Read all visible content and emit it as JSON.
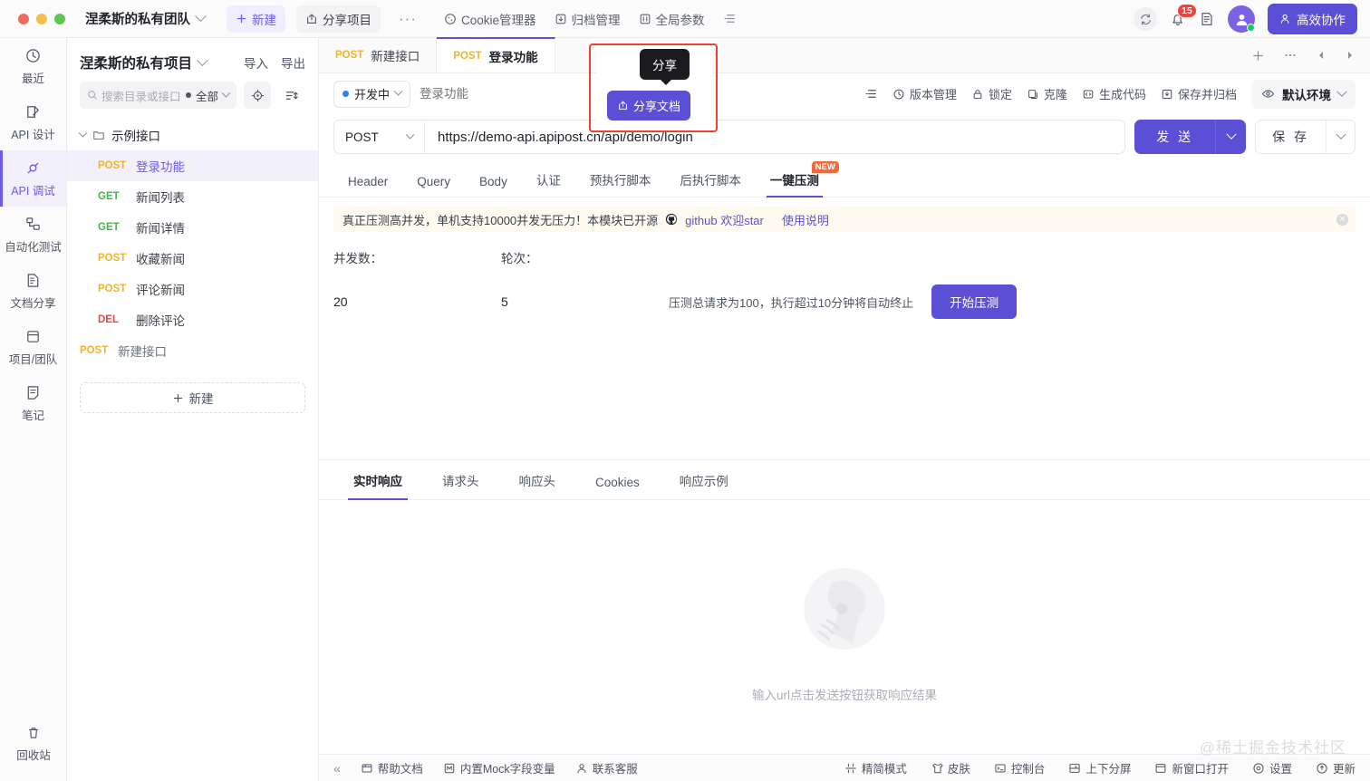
{
  "header": {
    "team_name": "涅柔斯的私有团队",
    "new_label": "新建",
    "share_project_label": "分享项目",
    "more_label": "···",
    "cookie_manager_label": "Cookie管理器",
    "archive_manager_label": "归档管理",
    "global_params_label": "全局参数",
    "notification_count": "15",
    "collab_label": "高效协作"
  },
  "rail": {
    "items": [
      {
        "label": "最近",
        "icon": "history-icon"
      },
      {
        "label": "API 设计",
        "icon": "design-icon"
      },
      {
        "label": "API 调试",
        "icon": "debug-icon"
      },
      {
        "label": "自动化测试",
        "icon": "automation-icon"
      },
      {
        "label": "文档分享",
        "icon": "doc-share-icon"
      },
      {
        "label": "项目/团队",
        "icon": "project-team-icon"
      },
      {
        "label": "笔记",
        "icon": "notes-icon"
      }
    ],
    "recycle_label": "回收站"
  },
  "sidebar": {
    "project_name": "涅柔斯的私有项目",
    "import_label": "导入",
    "export_label": "导出",
    "search_placeholder": "搜索目录或接口",
    "filter_label": "全部",
    "folder_label": "示例接口",
    "apis": [
      {
        "method": "POST",
        "name": "登录功能",
        "selected": true
      },
      {
        "method": "GET",
        "name": "新闻列表",
        "selected": false
      },
      {
        "method": "GET",
        "name": "新闻详情",
        "selected": false
      },
      {
        "method": "POST",
        "name": "收藏新闻",
        "selected": false
      },
      {
        "method": "POST",
        "name": "评论新闻",
        "selected": false
      },
      {
        "method": "DEL",
        "name": "删除评论",
        "selected": false
      }
    ],
    "root_api": {
      "method": "POST",
      "name": "新建接口"
    },
    "new_button_label": "新建"
  },
  "tabs": {
    "items": [
      {
        "method": "POST",
        "title": "新建接口",
        "active": false
      },
      {
        "method": "POST",
        "title": "登录功能",
        "active": true
      }
    ],
    "add_icon": "plus-icon",
    "more_icon": "ellipsis-icon",
    "prev_icon": "triangle-left-icon",
    "next_icon": "triangle-right-icon"
  },
  "request": {
    "status_label": "开发中",
    "name_placeholder": "登录功能",
    "toolbar": [
      {
        "label": "版本管理",
        "icon": "clock-icon"
      },
      {
        "label": "锁定",
        "icon": "lock-icon"
      },
      {
        "label": "克隆",
        "icon": "copy-icon"
      },
      {
        "label": "生成代码",
        "icon": "code-icon"
      },
      {
        "label": "保存并归档",
        "icon": "archive-icon"
      }
    ],
    "env_label": "默认环境",
    "method": "POST",
    "url": "https://demo-api.apipost.cn/api/demo/login",
    "send_label": "发 送",
    "save_label": "保 存"
  },
  "subtabs": [
    {
      "label": "Header",
      "active": false,
      "badge": ""
    },
    {
      "label": "Query",
      "active": false,
      "badge": ""
    },
    {
      "label": "Body",
      "active": false,
      "badge": ""
    },
    {
      "label": "认证",
      "active": false,
      "badge": ""
    },
    {
      "label": "预执行脚本",
      "active": false,
      "badge": ""
    },
    {
      "label": "后执行脚本",
      "active": false,
      "badge": ""
    },
    {
      "label": "一键压测",
      "active": true,
      "badge": "NEW"
    }
  ],
  "banner": {
    "text": "真正压测高并发，单机支持10000并发无压力！本模块已开源",
    "github_label": "github 欢迎star",
    "usage_label": "使用说明"
  },
  "stress": {
    "concurrency_label": "并发数：",
    "rounds_label": "轮次：",
    "concurrency_value": "20",
    "rounds_value": "5",
    "hint": "压测总请求为100，执行超过10分钟将自动终止",
    "start_label": "开始压测"
  },
  "response": {
    "tabs": [
      {
        "label": "实时响应",
        "active": true
      },
      {
        "label": "请求头",
        "active": false
      },
      {
        "label": "响应头",
        "active": false
      },
      {
        "label": "Cookies",
        "active": false
      },
      {
        "label": "响应示例",
        "active": false
      }
    ],
    "empty_text": "输入url点击发送按钮获取响应结果"
  },
  "share_popup": {
    "tooltip": "分享",
    "button_label": "分享文档"
  },
  "bottombar": {
    "left": [
      {
        "label": "帮助文档",
        "icon": "book-icon"
      },
      {
        "label": "内置Mock字段变量",
        "icon": "mock-icon"
      },
      {
        "label": "联系客服",
        "icon": "user-icon"
      }
    ],
    "right": [
      {
        "label": "精简模式",
        "icon": "compact-icon"
      },
      {
        "label": "皮肤",
        "icon": "skin-icon"
      },
      {
        "label": "控制台",
        "icon": "console-icon"
      },
      {
        "label": "上下分屏",
        "icon": "split-icon"
      },
      {
        "label": "新窗口打开",
        "icon": "newwindow-icon"
      },
      {
        "label": "设置",
        "icon": "settings-icon"
      },
      {
        "label": "更新",
        "icon": "update-icon"
      }
    ]
  },
  "watermark": "@稀土掘金技术社区",
  "colors": {
    "accent": "#5b4fd6",
    "accent_light": "#6c5ce7",
    "highlight": "#f0402f",
    "post": "#f0b429",
    "get": "#4cb050",
    "del": "#e04a3f",
    "badge_red": "#f53f3f"
  }
}
